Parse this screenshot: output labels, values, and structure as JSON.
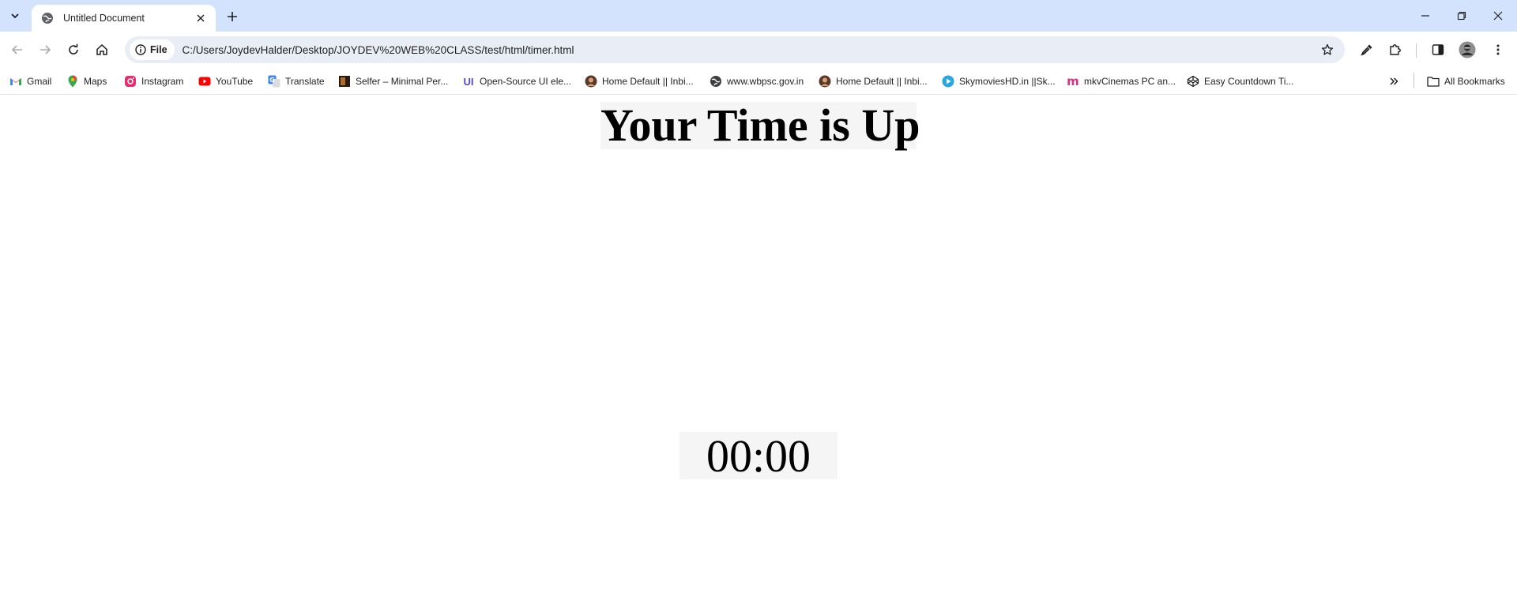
{
  "tabstrip": {
    "tab_title": "Untitled Document"
  },
  "toolbar": {
    "chip_label": "File",
    "url": "C:/Users/JoydevHalder/Desktop/JOYDEV%20WEB%20CLASS/test/html/timer.html"
  },
  "bookmarks": {
    "items": [
      {
        "label": "Gmail",
        "icon": "gmail-icon",
        "color": "#ea4335"
      },
      {
        "label": "Maps",
        "icon": "maps-pin-icon",
        "color": "#34a853"
      },
      {
        "label": "Instagram",
        "icon": "instagram-icon",
        "color": "#e1306c"
      },
      {
        "label": "YouTube",
        "icon": "youtube-icon",
        "color": "#ff0000"
      },
      {
        "label": "Translate",
        "icon": "translate-icon",
        "color": "#4285f4"
      },
      {
        "label": "Selfer – Minimal Per...",
        "icon": "selfer-icon",
        "color": "#6b3a1f"
      },
      {
        "label": "Open-Source UI ele...",
        "icon": "ui-logo-icon",
        "color": "#4f46e5"
      },
      {
        "label": "Home Default || Inbi...",
        "icon": "avatar-icon",
        "color": "#5a3b2a"
      },
      {
        "label": "www.wbpsc.gov.in",
        "icon": "globe-icon",
        "color": "#3c4043"
      },
      {
        "label": "Home Default || Inbi...",
        "icon": "avatar-icon",
        "color": "#5a3b2a"
      },
      {
        "label": "SkymoviesHD.in ||Sk...",
        "icon": "play-icon",
        "color": "#29a8e0"
      },
      {
        "label": "mkvCinemas PC an...",
        "icon": "m-logo-icon",
        "color": "#d63384"
      },
      {
        "label": "Easy Countdown Ti...",
        "icon": "codepen-icon",
        "color": "#1f1f1f"
      }
    ],
    "all_bookmarks": "All Bookmarks"
  },
  "page": {
    "heading": "Your Time is Up",
    "timer": "00:00"
  }
}
